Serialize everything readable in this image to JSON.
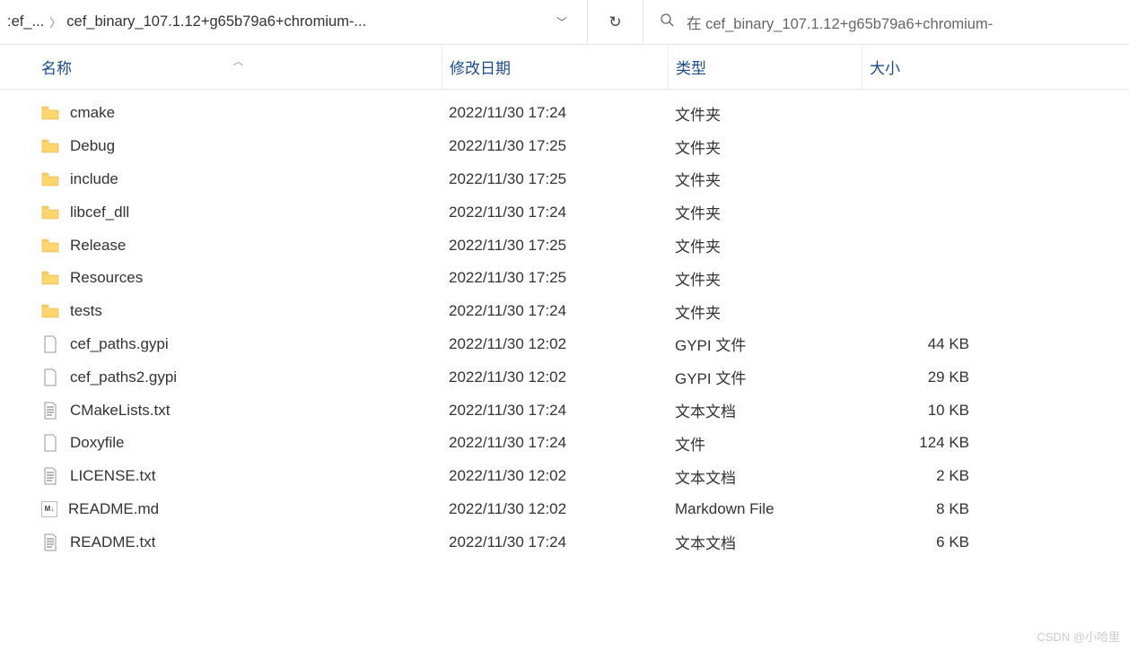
{
  "breadcrumb": {
    "segment1": ":ef_...",
    "segment2": "cef_binary_107.1.12+g65b79a6+chromium-..."
  },
  "search": {
    "placeholder": "在 cef_binary_107.1.12+g65b79a6+chromium-"
  },
  "columns": {
    "name": "名称",
    "date": "修改日期",
    "type": "类型",
    "size": "大小"
  },
  "files": [
    {
      "icon": "folder",
      "name": "cmake",
      "date": "2022/11/30 17:24",
      "type": "文件夹",
      "size": ""
    },
    {
      "icon": "folder",
      "name": "Debug",
      "date": "2022/11/30 17:25",
      "type": "文件夹",
      "size": ""
    },
    {
      "icon": "folder",
      "name": "include",
      "date": "2022/11/30 17:25",
      "type": "文件夹",
      "size": ""
    },
    {
      "icon": "folder",
      "name": "libcef_dll",
      "date": "2022/11/30 17:24",
      "type": "文件夹",
      "size": ""
    },
    {
      "icon": "folder",
      "name": "Release",
      "date": "2022/11/30 17:25",
      "type": "文件夹",
      "size": ""
    },
    {
      "icon": "folder",
      "name": "Resources",
      "date": "2022/11/30 17:25",
      "type": "文件夹",
      "size": ""
    },
    {
      "icon": "folder",
      "name": "tests",
      "date": "2022/11/30 17:24",
      "type": "文件夹",
      "size": ""
    },
    {
      "icon": "file",
      "name": "cef_paths.gypi",
      "date": "2022/11/30 12:02",
      "type": "GYPI 文件",
      "size": "44 KB"
    },
    {
      "icon": "file",
      "name": "cef_paths2.gypi",
      "date": "2022/11/30 12:02",
      "type": "GYPI 文件",
      "size": "29 KB"
    },
    {
      "icon": "text",
      "name": "CMakeLists.txt",
      "date": "2022/11/30 17:24",
      "type": "文本文档",
      "size": "10 KB"
    },
    {
      "icon": "file",
      "name": "Doxyfile",
      "date": "2022/11/30 17:24",
      "type": "文件",
      "size": "124 KB"
    },
    {
      "icon": "text",
      "name": "LICENSE.txt",
      "date": "2022/11/30 12:02",
      "type": "文本文档",
      "size": "2 KB"
    },
    {
      "icon": "md",
      "name": "README.md",
      "date": "2022/11/30 12:02",
      "type": "Markdown File",
      "size": "8 KB"
    },
    {
      "icon": "text",
      "name": "README.txt",
      "date": "2022/11/30 17:24",
      "type": "文本文档",
      "size": "6 KB"
    }
  ],
  "watermark": "CSDN @小哈里"
}
